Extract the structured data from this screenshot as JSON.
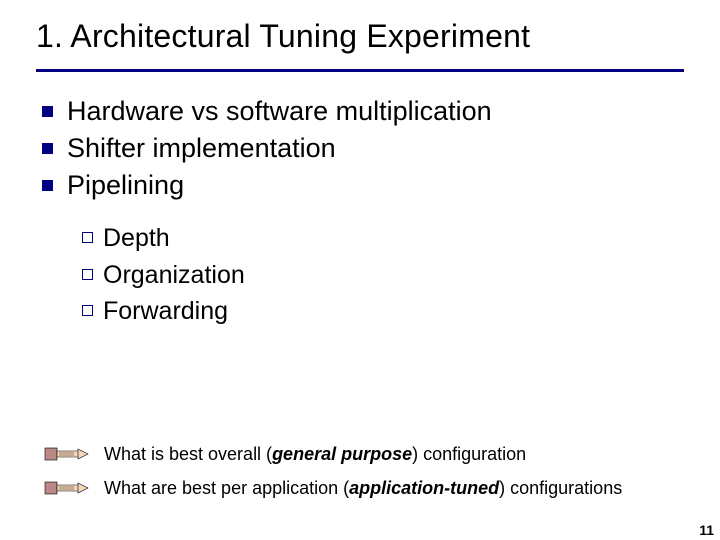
{
  "title": "1. Architectural Tuning Experiment",
  "bullets": [
    "Hardware vs software multiplication",
    "Shifter implementation",
    "Pipelining"
  ],
  "subbullets": [
    "Depth",
    "Organization",
    "Forwarding"
  ],
  "notes": {
    "line1_pre": "What is best overall (",
    "line1_em": "general purpose",
    "line1_post": ") configuration",
    "line2_pre": "What are best per application (",
    "line2_em": "application-tuned",
    "line2_post": ") configurations"
  },
  "page_number": "11"
}
